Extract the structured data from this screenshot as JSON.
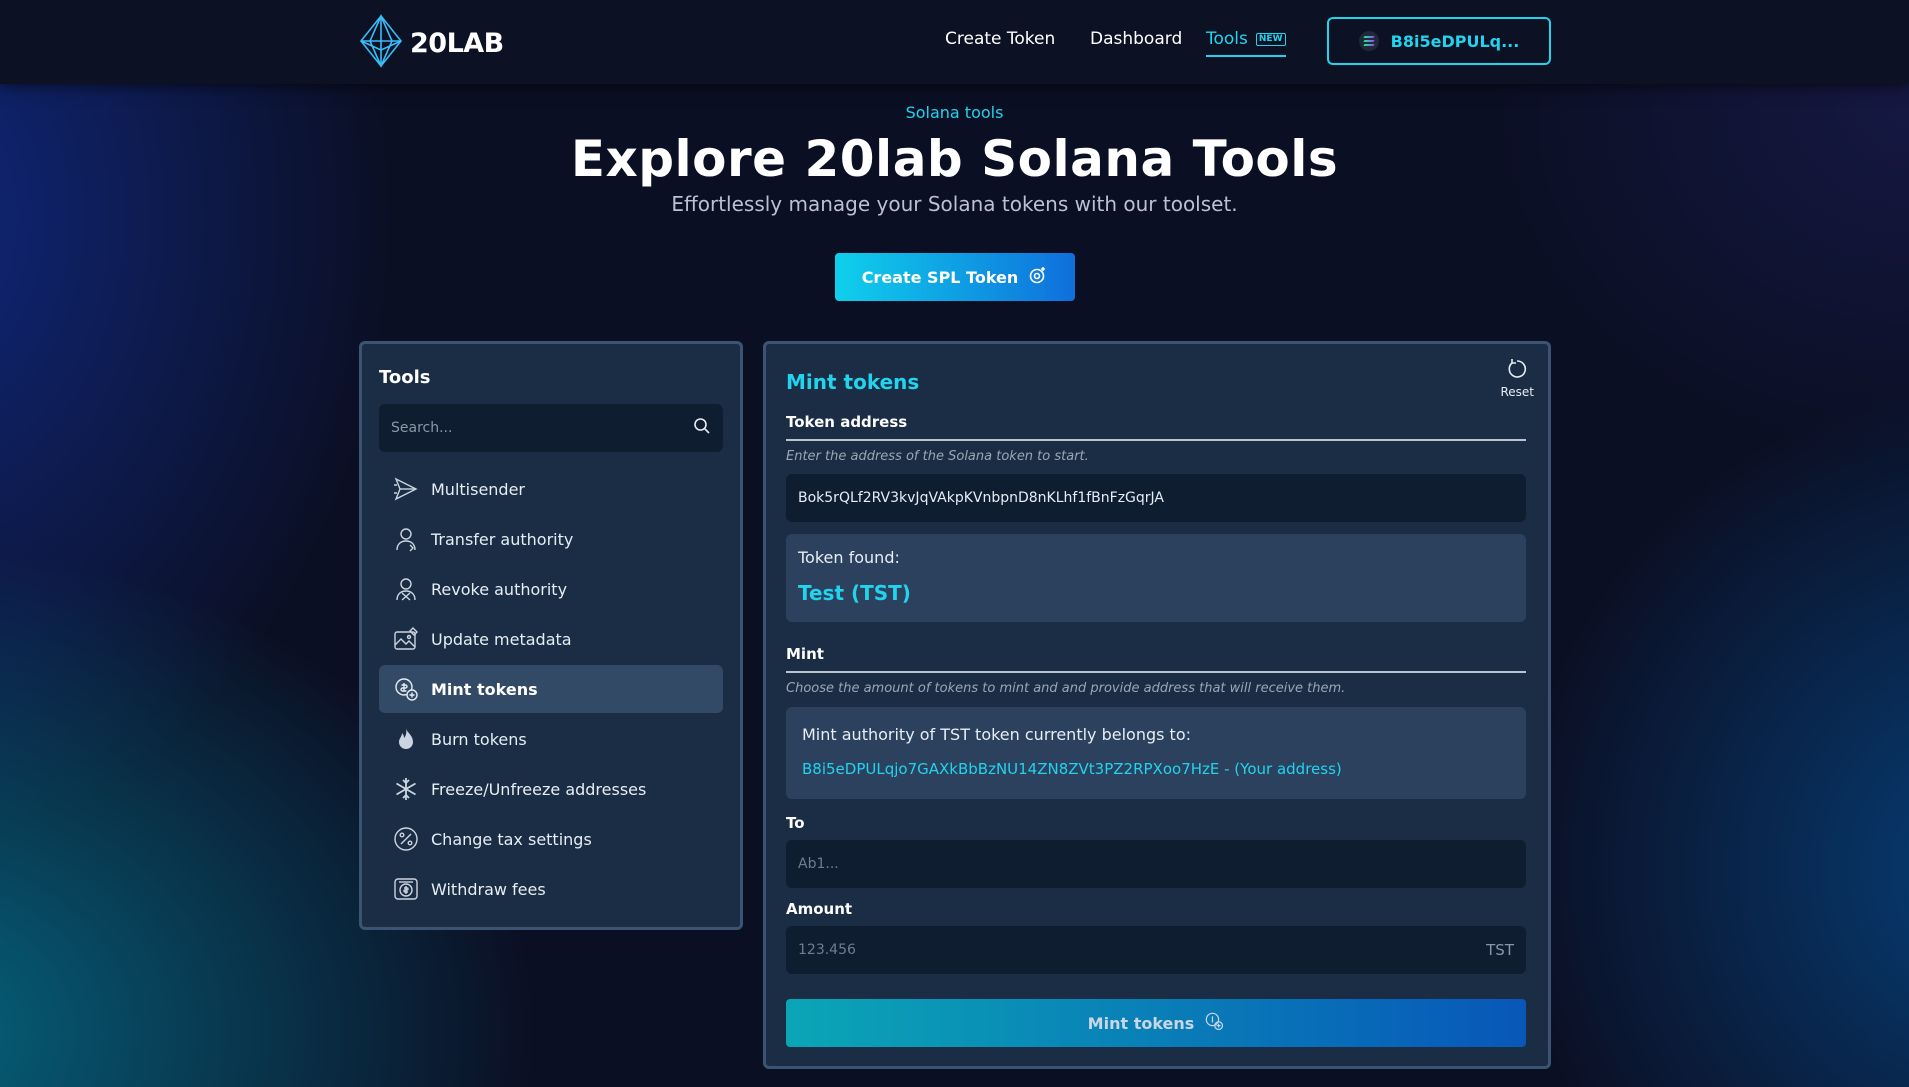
{
  "brand": {
    "name": "20LAB"
  },
  "nav": {
    "create_token": "Create Token",
    "dashboard": "Dashboard",
    "tools": "Tools",
    "tools_badge": "NEW",
    "wallet": "B8i5eDPULq..."
  },
  "hero": {
    "eyebrow": "Solana tools",
    "title": "Explore 20lab Solana Tools",
    "subtitle": "Effortlessly manage your Solana tokens with our toolset.",
    "cta": "Create SPL Token"
  },
  "tools_panel": {
    "title": "Tools",
    "search_placeholder": "Search...",
    "items": [
      {
        "label": "Multisender",
        "icon": "send-icon"
      },
      {
        "label": "Transfer authority",
        "icon": "user-icon"
      },
      {
        "label": "Revoke authority",
        "icon": "user-x-icon"
      },
      {
        "label": "Update metadata",
        "icon": "image-edit-icon"
      },
      {
        "label": "Mint tokens",
        "icon": "coins-plus-icon",
        "active": true
      },
      {
        "label": "Burn tokens",
        "icon": "flame-icon"
      },
      {
        "label": "Freeze/Unfreeze addresses",
        "icon": "snowflake-icon"
      },
      {
        "label": "Change tax settings",
        "icon": "percent-icon"
      },
      {
        "label": "Withdraw fees",
        "icon": "dollar-icon"
      }
    ]
  },
  "main": {
    "title": "Mint tokens",
    "reset": "Reset",
    "token_address_label": "Token address",
    "token_address_hint": "Enter the address of the Solana token to start.",
    "token_address_value": "Bok5rQLf2RV3kvJqVAkpKVnbpnD8nKLhf1fBnFzGqrJA",
    "token_found_label": "Token found:",
    "token_found_value": "Test (TST)",
    "mint_label": "Mint",
    "mint_hint": "Choose the amount of tokens to mint and and provide address that will receive them.",
    "authority_text": "Mint authority of TST token currently belongs to:",
    "authority_address": "B8i5eDPULqjo7GAXkBbBzNU14ZN8ZVt3PZ2RPXoo7HzE - (Your address)",
    "to_label": "To",
    "to_placeholder": "Ab1...",
    "amount_label": "Amount",
    "amount_placeholder": "123.456",
    "amount_unit": "TST",
    "submit": "Mint tokens"
  },
  "colors": {
    "accent": "#22d3ee",
    "panel": "#1b2d44",
    "panel_border": "#3b5472",
    "field": "#0f1d31",
    "background": "#0b0f24"
  }
}
